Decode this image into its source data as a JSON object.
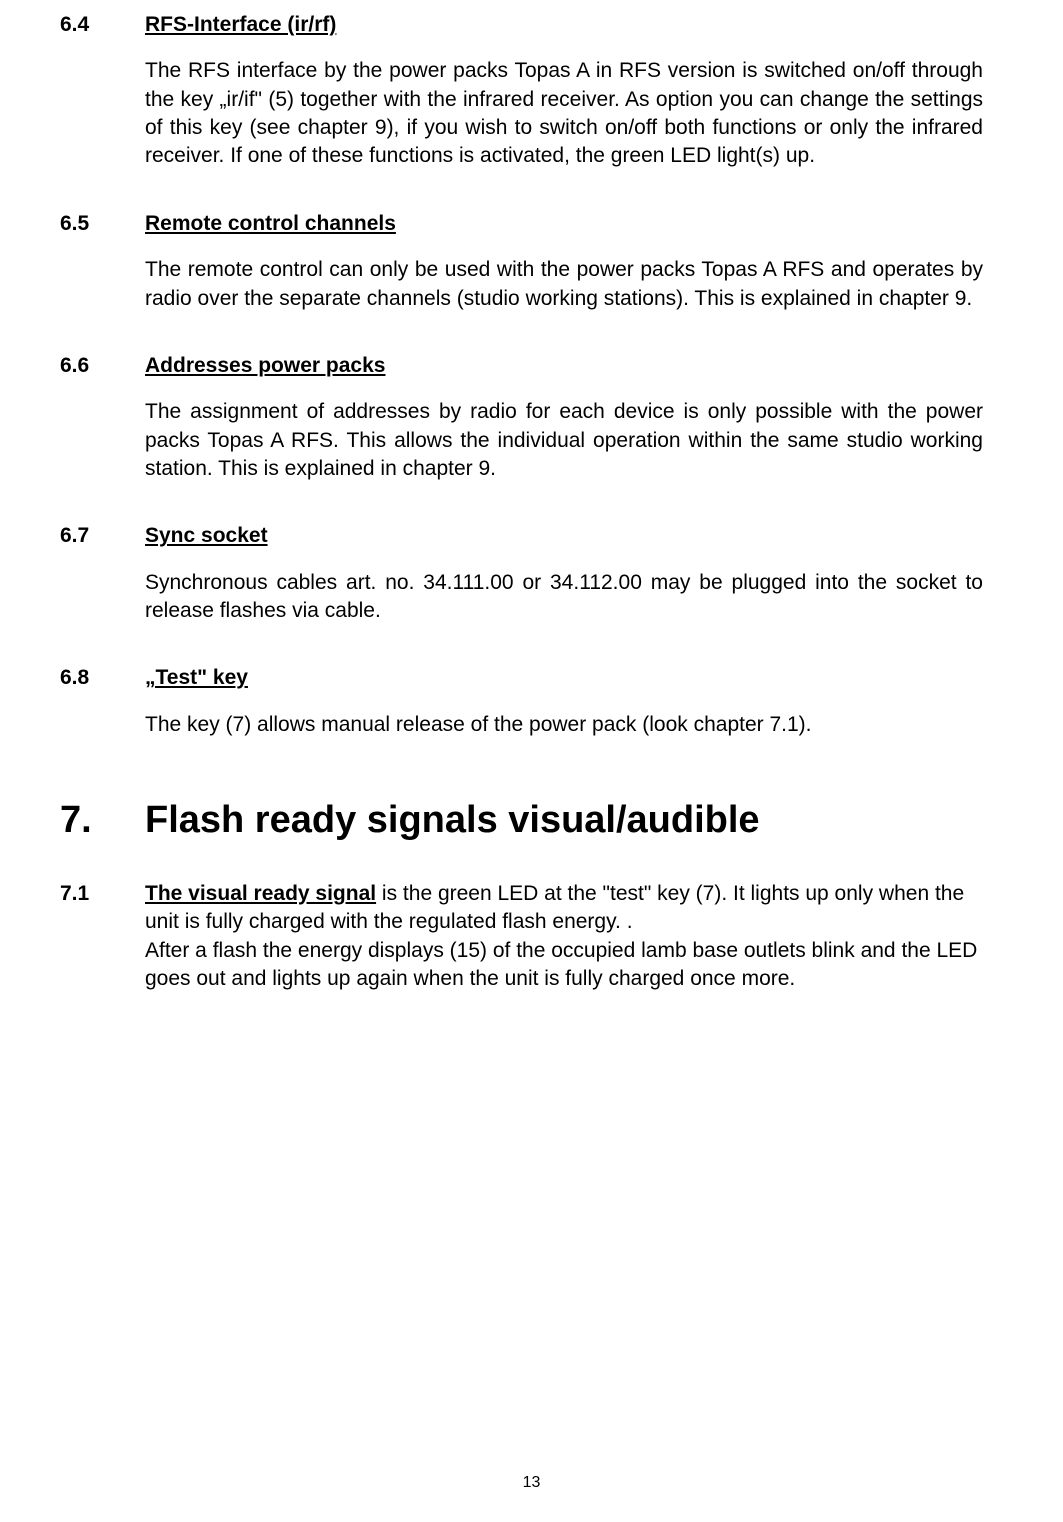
{
  "sections": {
    "s64": {
      "num": "6.4",
      "heading": "RFS-Interface (ir/rf)",
      "body": "The RFS interface by the power packs Topas A in RFS version is switched on/off through the key „ir/if\" (5) together with the infrared receiver. As option you can change the settings of this key (see chapter 9), if you wish to switch on/off both functions or only the infrared receiver. If one of these functions is activated, the green LED light(s) up."
    },
    "s65": {
      "num": "6.5",
      "heading": "Remote control channels",
      "body": "The remote control can only be used with the power packs Topas A RFS and operates by radio over the separate channels (studio working stations). This is explained in chapter 9."
    },
    "s66": {
      "num": "6.6",
      "heading": "Addresses power packs",
      "body": "The assignment of addresses by radio for each device is only possible with the power packs Topas A RFS. This allows the individual operation within the same studio working station. This is explained in chapter 9."
    },
    "s67": {
      "num": "6.7",
      "heading": "Sync socket",
      "body": "Synchronous cables art. no. 34.111.00 or 34.112.00 may be plugged into the socket to release flashes via cable."
    },
    "s68": {
      "num": "6.8",
      "heading": "„Test\" key",
      "body": "The key (7) allows manual release of the power pack (look chapter 7.1)."
    }
  },
  "chapter": {
    "num": "7.",
    "title": "Flash ready signals visual/audible"
  },
  "s71": {
    "num": "7.1",
    "lead": "The visual ready signal",
    "rest1": " is the green LED at the \"test\" key (7). It lights up only when the unit is fully charged with the regulated flash energy.   .",
    "line2": "After a flash the energy displays (15) of the occupied lamb base outlets blink and the LED goes out and lights up again when the unit is fully charged once more."
  },
  "pageNumber": "13"
}
